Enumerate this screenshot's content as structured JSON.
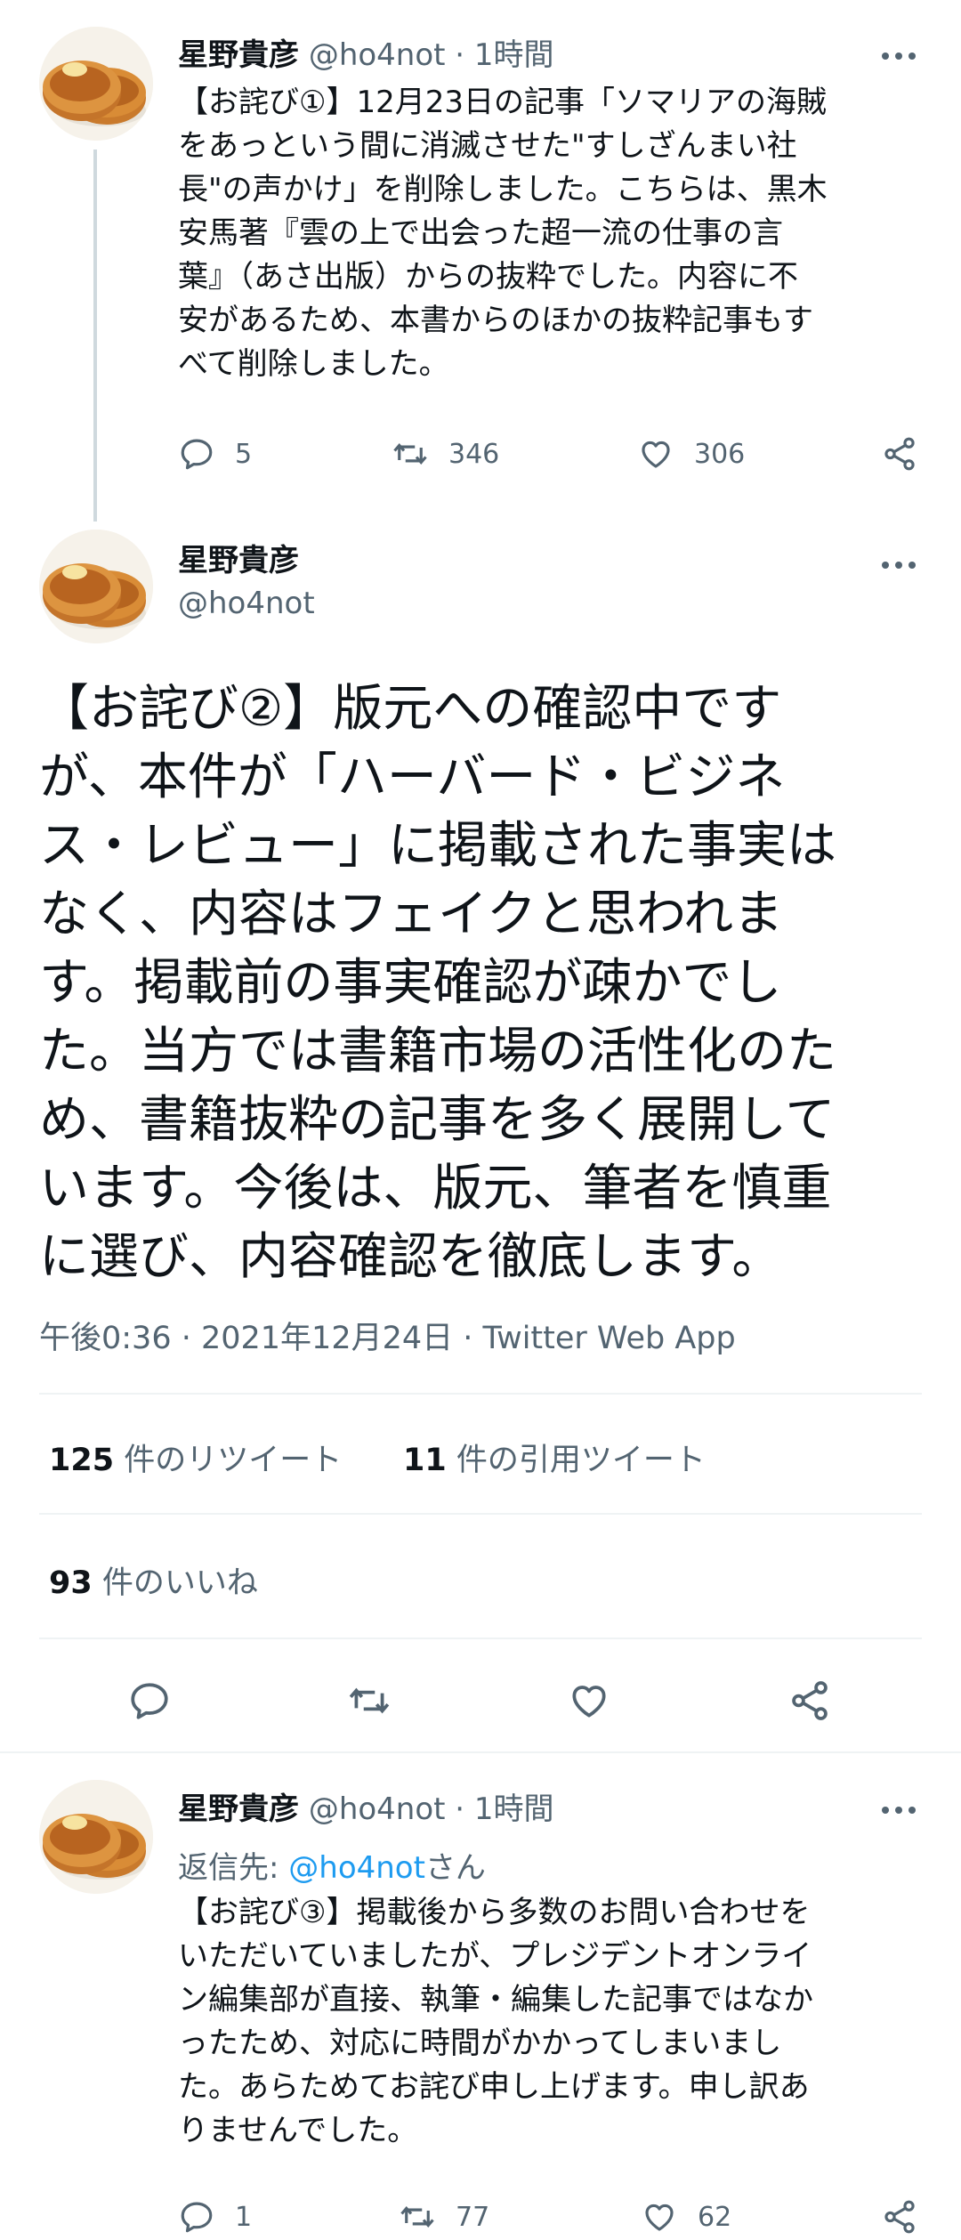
{
  "tweet1": {
    "name": "星野貴彦",
    "handle": "@ho4not",
    "time": "1時間",
    "lines": [
      "【お詫び①】12月23日の記事「ソマリアの海賊",
      "をあっという間に消滅させた\"すしざんまい社",
      "長\"の声かけ」を削除しました。こちらは、黒木",
      "安馬著『雲の上で出会った超一流の仕事の言",
      "葉』（あさ出版）からの抜粋でした。内容に不",
      "安があるため、本書からのほかの抜粋記事もす",
      "べて削除しました。"
    ],
    "replies": "5",
    "retweets": "346",
    "likes": "306"
  },
  "main_tweet": {
    "name": "星野貴彦",
    "handle": "@ho4not",
    "lines": [
      "【お詫び②】版元への確認中です",
      "が、本件が「ハーバード・ビジネ",
      "ス・レビュー」に掲載された事実は",
      "なく、内容はフェイクと思われま",
      "す。掲載前の事実確認が疎かでし",
      "た。当方では書籍市場の活性化のた",
      "め、書籍抜粋の記事を多く展開して",
      "います。今後は、版元、筆者を慎重",
      "に選び、内容確認を徹底します。"
    ],
    "timestamp": "午後0:36 · 2021年12月24日 · Twitter Web App",
    "retweet_count": "125",
    "retweet_label": " 件のリツイート",
    "quote_count": "11",
    "quote_label": " 件の引用ツイート",
    "like_count": "93",
    "like_label": " 件のいいね"
  },
  "tweet3": {
    "name": "星野貴彦",
    "handle": "@ho4not",
    "time": "1時間",
    "reply_prefix": "返信先: ",
    "reply_to": "@ho4not",
    "reply_suffix": "さん",
    "lines": [
      "【お詫び③】掲載後から多数のお問い合わせを",
      "いただいていましたが、プレジデントオンライ",
      "ン編集部が直接、執筆・編集した記事ではなか",
      "ったため、対応に時間がかかってしまいまし",
      "た。あらためてお詫び申し上げます。申し訳あ",
      "りませんでした。"
    ],
    "replies": "1",
    "retweets": "77",
    "likes": "62"
  },
  "separator": "·",
  "icons": [
    "more-icon",
    "reply-icon",
    "retweet-icon",
    "like-icon",
    "share-icon"
  ],
  "colors": {
    "text": "#0f1419",
    "muted": "#536471",
    "link": "#1d9bf0",
    "divider": "#eff3f4",
    "thread_line": "#cfd9de"
  }
}
